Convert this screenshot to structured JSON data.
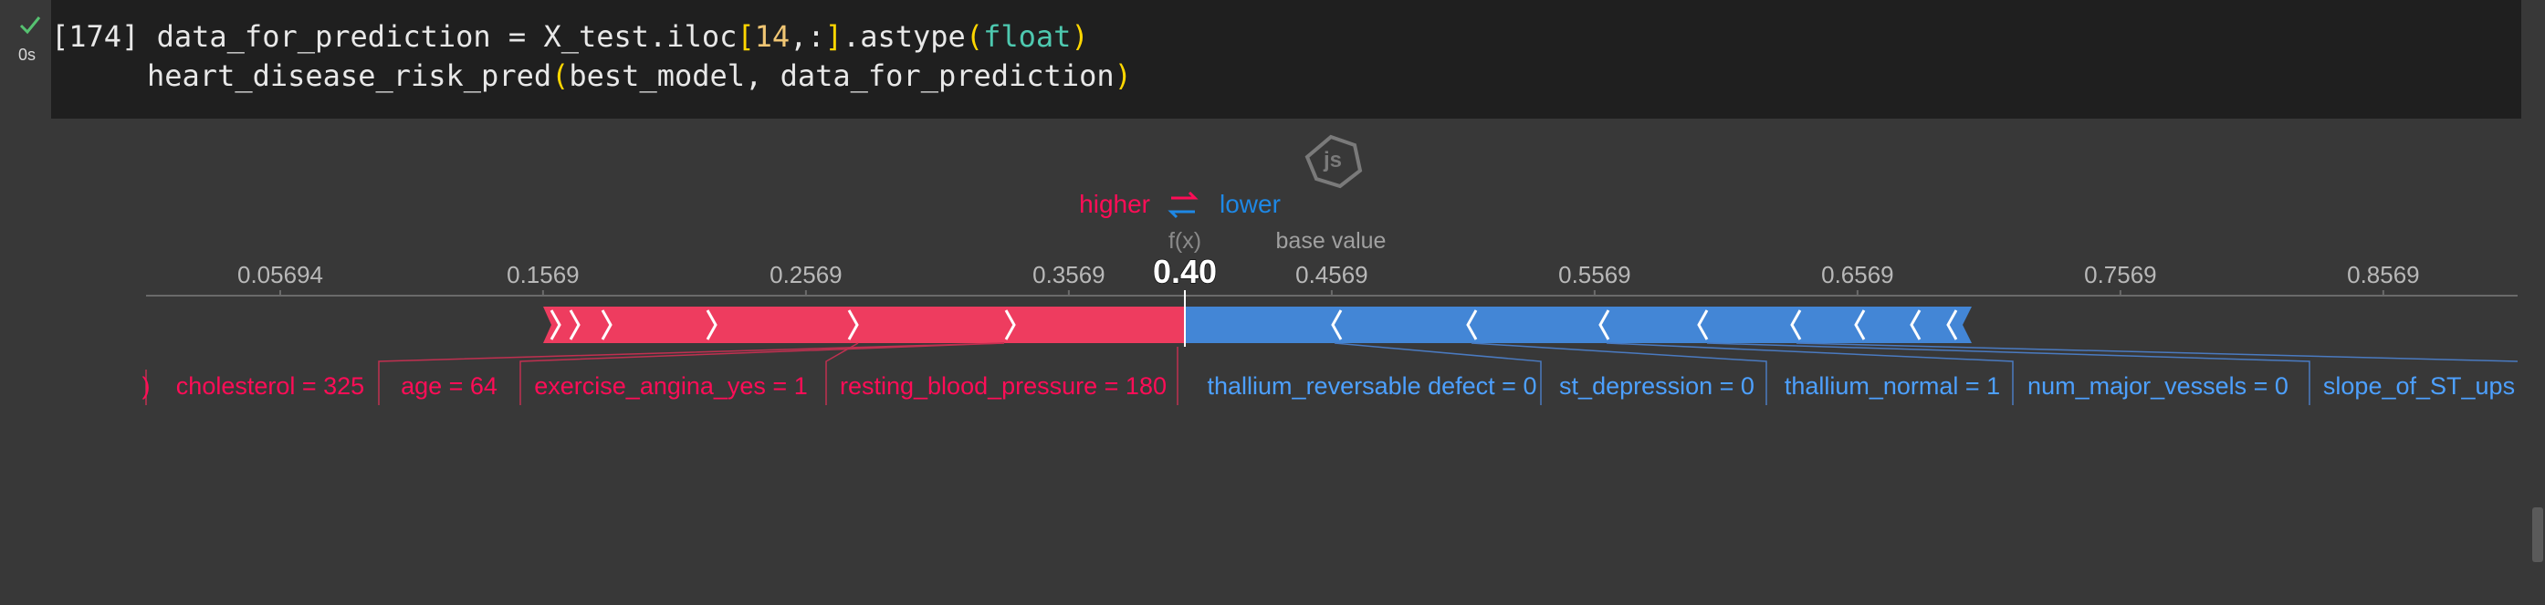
{
  "cell": {
    "exec_count": "[174]",
    "exec_time": "0s",
    "code": {
      "l1_var": "data_for_prediction = X_test.iloc",
      "l1_open": "[",
      "l1_num": "14",
      "l1_mid": ",:",
      "l1_close": "]",
      "l1_method": ".astype",
      "l1_p_open": "(",
      "l1_type": "float",
      "l1_p_close": ")",
      "l2_fn": "heart_disease_risk_pred",
      "l2_p_open": "(",
      "l2_args": "best_model, data_for_prediction",
      "l2_p_close": ")"
    }
  },
  "output": {
    "js_badge": "js",
    "legend": {
      "higher": "higher",
      "lower": "lower"
    },
    "fx_label": "f(x)",
    "base_label": "base value",
    "fx_value": "0.40",
    "axis_ticks": [
      "0.05694",
      "0.1569",
      "0.2569",
      "0.3569",
      "0.4569",
      "0.5569",
      "0.6569",
      "0.7569",
      "0.8569"
    ],
    "pos_features": [
      "cholesterol = 325",
      "age = 64",
      "exercise_angina_yes = 1",
      "resting_blood_pressure = 180"
    ],
    "neg_features": [
      "thallium_reversable defect = 0",
      "st_depression = 0",
      "thallium_normal = 1",
      "num_major_vessels = 0",
      "slope_of_ST_ups"
    ],
    "truncated_left": ")"
  },
  "colors": {
    "positive": "#ff0d57",
    "negative": "#1e88e5",
    "background": "#383838",
    "code_bg": "#1f1f1f"
  },
  "chart_data": {
    "type": "bar",
    "x": [
      0.05694,
      0.1569,
      0.2569,
      0.3569,
      0.4569,
      0.5569,
      0.6569,
      0.7569,
      0.8569
    ],
    "output_value": 0.4,
    "base_value": 0.4569,
    "xlim": [
      0.0,
      0.9
    ]
  }
}
